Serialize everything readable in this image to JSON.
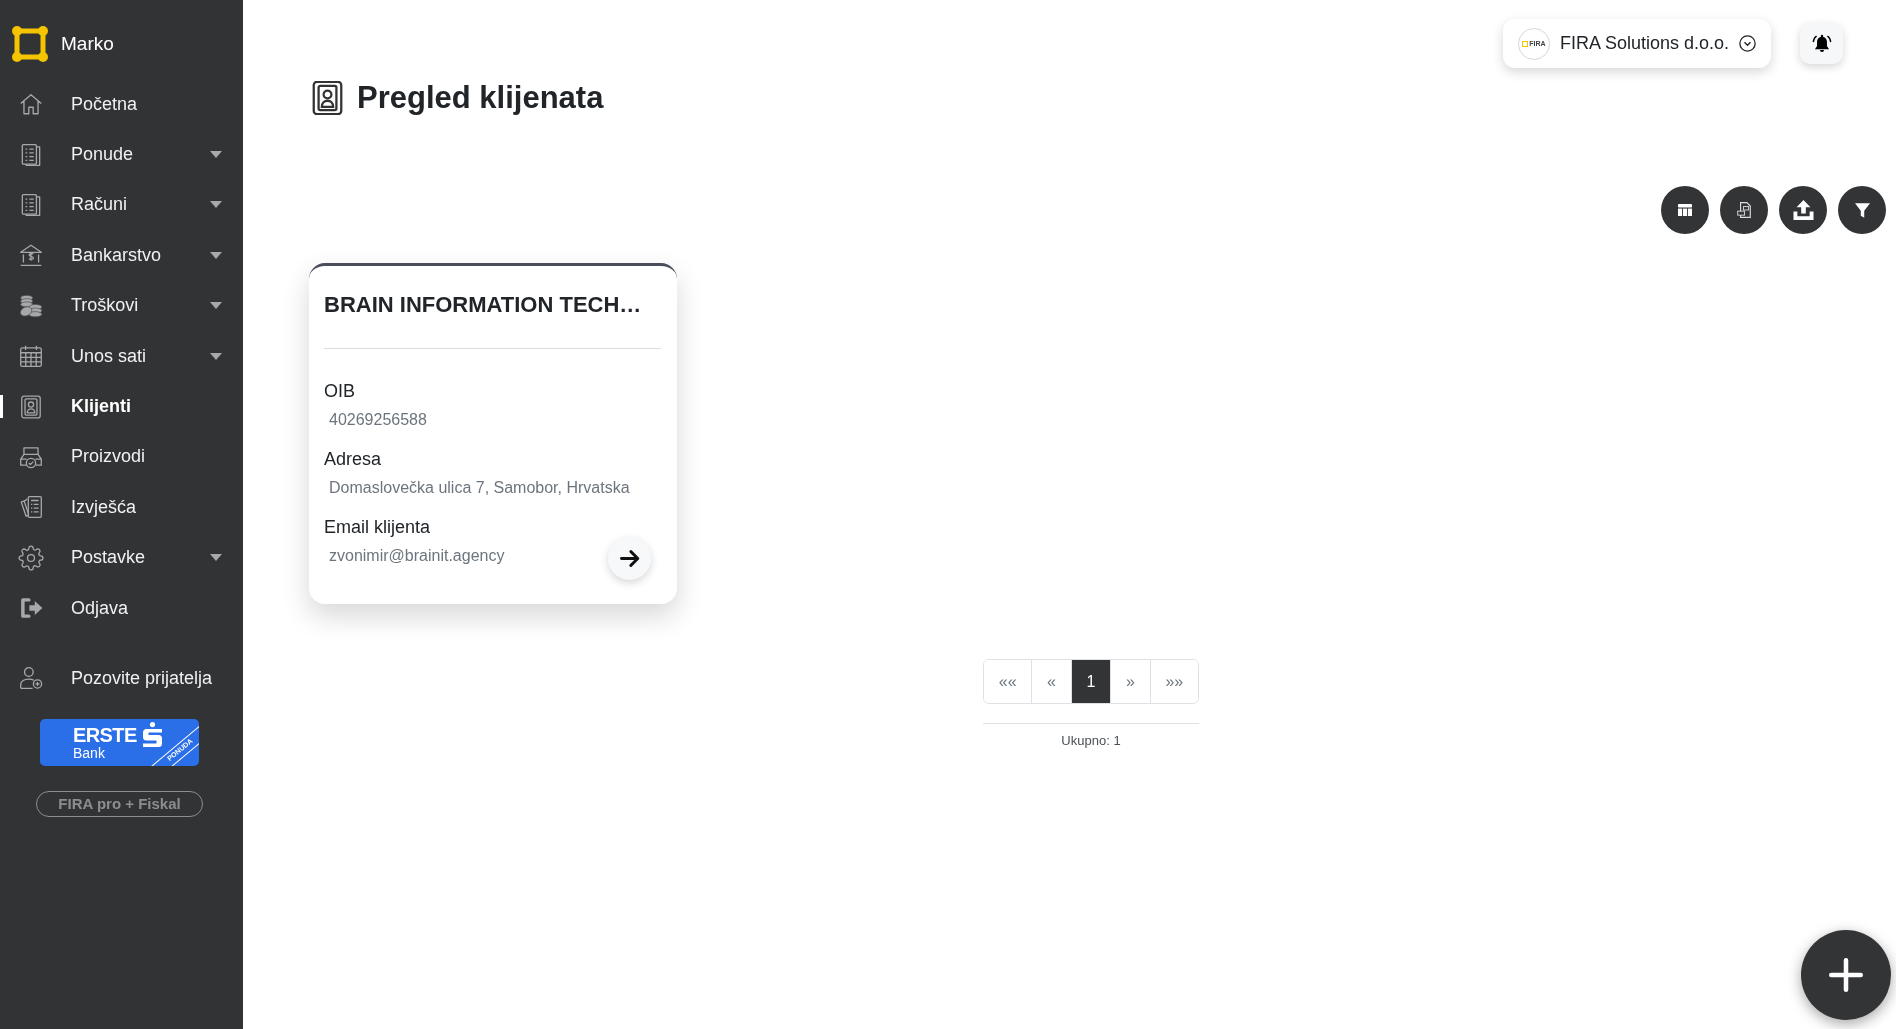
{
  "sidebar": {
    "user_name": "Marko",
    "items": [
      {
        "label": "Početna",
        "has_submenu": false,
        "selected": false
      },
      {
        "label": "Ponude",
        "has_submenu": true,
        "selected": false
      },
      {
        "label": "Računi",
        "has_submenu": true,
        "selected": false
      },
      {
        "label": "Bankarstvo",
        "has_submenu": true,
        "selected": false
      },
      {
        "label": "Troškovi",
        "has_submenu": true,
        "selected": false
      },
      {
        "label": "Unos sati",
        "has_submenu": true,
        "selected": false
      },
      {
        "label": "Klijenti",
        "has_submenu": false,
        "selected": true
      },
      {
        "label": "Proizvodi",
        "has_submenu": false,
        "selected": false
      },
      {
        "label": "Izvješća",
        "has_submenu": false,
        "selected": false
      },
      {
        "label": "Postavke",
        "has_submenu": true,
        "selected": false
      },
      {
        "label": "Odjava",
        "has_submenu": false,
        "selected": false
      }
    ],
    "invite_link": "Pozovite prijatelja",
    "promo_banner": {
      "brand": "ERSTE",
      "subtitle": "Bank",
      "ribbon": "PONUDA"
    },
    "plan_badge": "FIRA pro + Fiskal"
  },
  "header": {
    "company_selector": {
      "logo_text": "FIRA",
      "name": "FIRA Solutions d.o.o."
    }
  },
  "page_title": "Pregled klijenata",
  "client_cards": [
    {
      "name": "BRAIN INFORMATION TECH…",
      "fields": [
        {
          "label": "OIB",
          "value": "40269256588"
        },
        {
          "label": "Adresa",
          "value": "Domaslovečka ulica 7, Samobor, Hrvatska"
        },
        {
          "label": "Email klijenta",
          "value": "zvonimir@brainit.agency"
        }
      ]
    }
  ],
  "pagination": {
    "buttons": [
      {
        "label": "««",
        "selected": false
      },
      {
        "label": "«",
        "selected": false
      },
      {
        "label": "1",
        "selected": true
      },
      {
        "label": "»",
        "selected": false
      },
      {
        "label": "»»",
        "selected": false
      }
    ],
    "total": "Ukupno: 1"
  }
}
